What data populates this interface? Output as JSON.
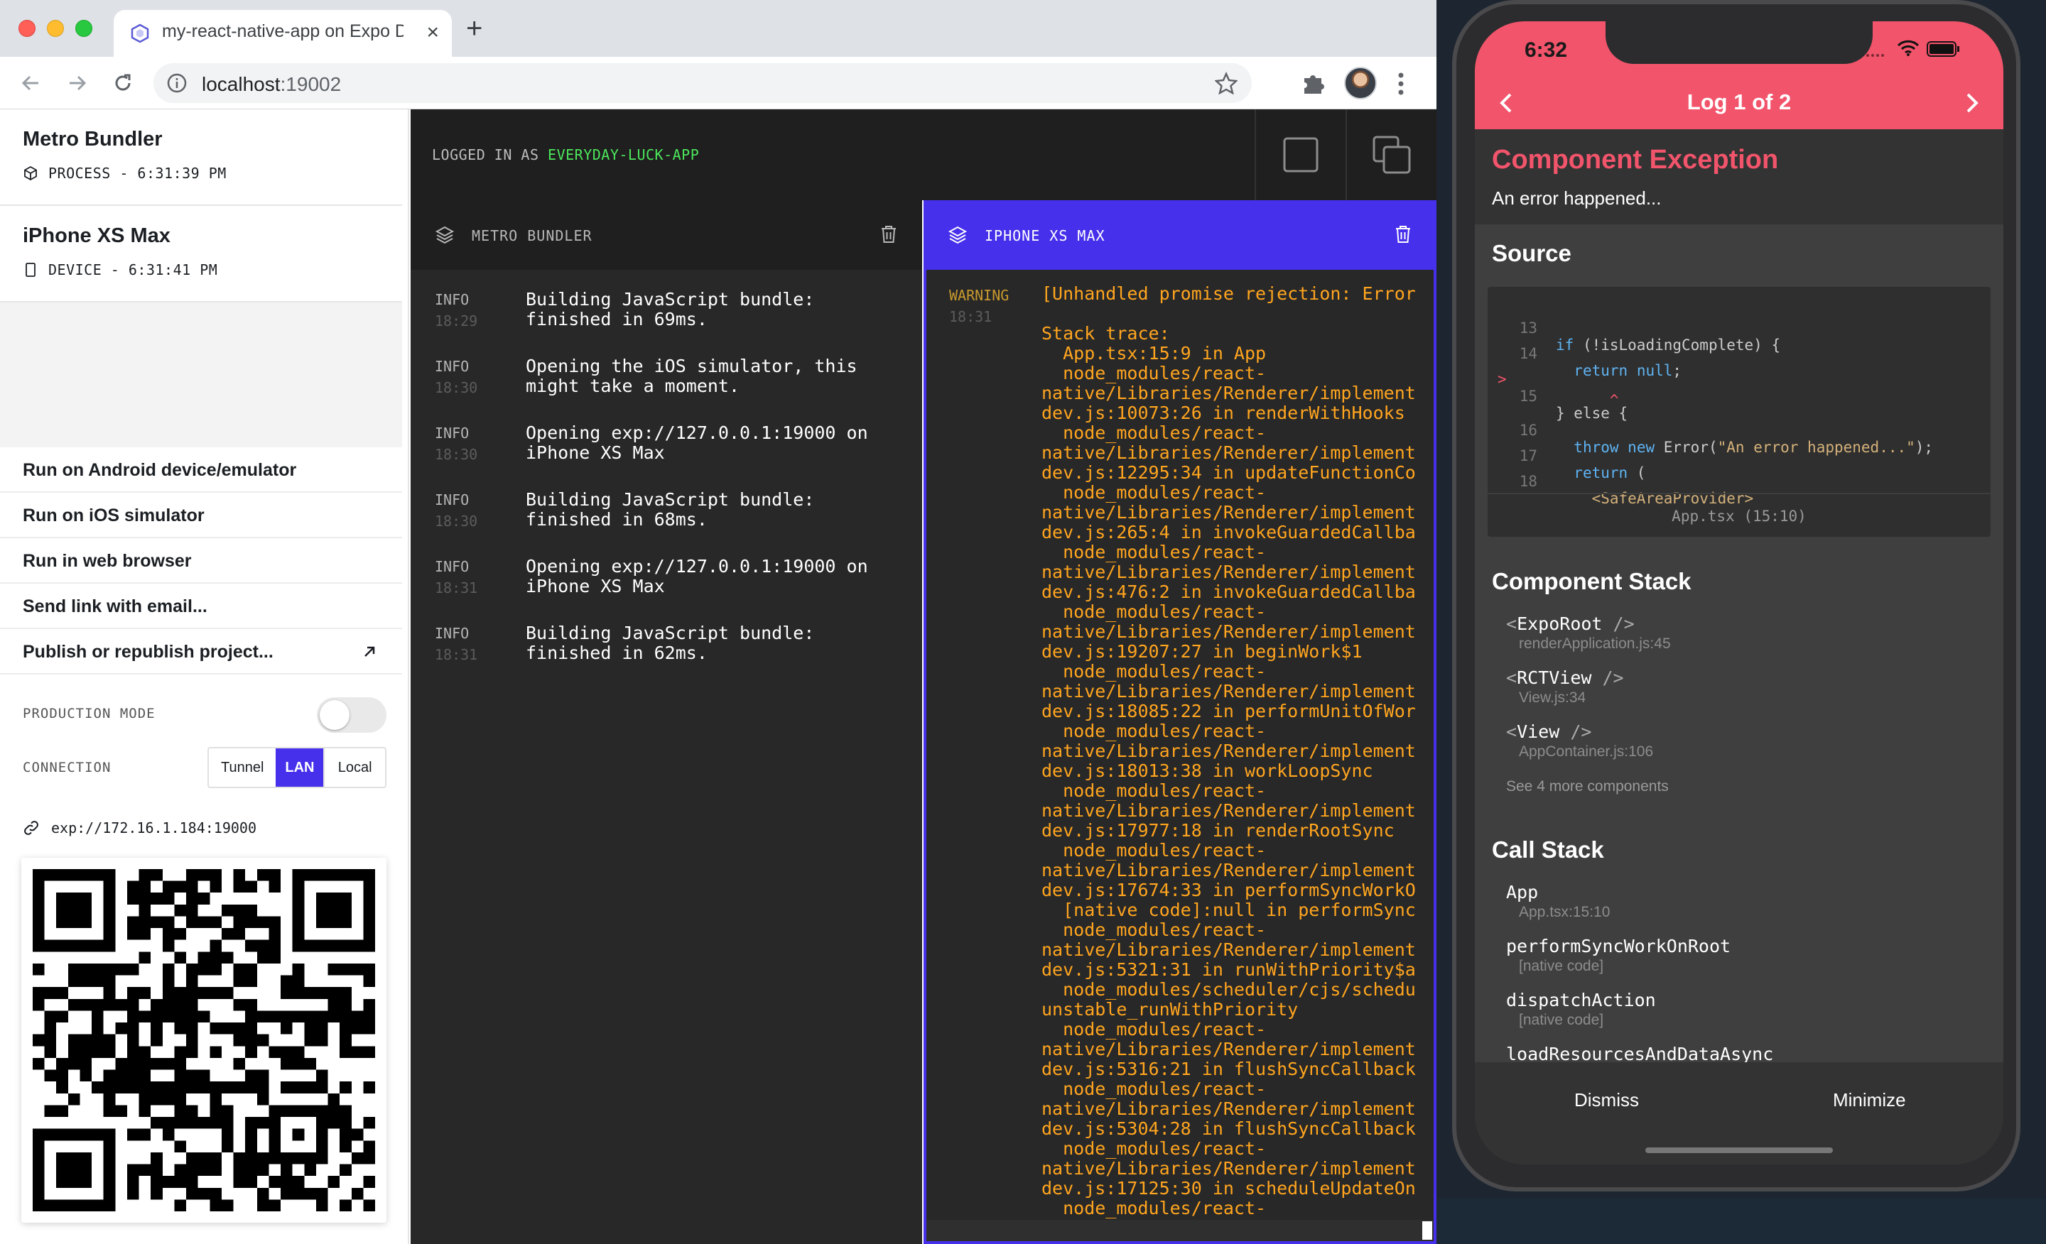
{
  "browser": {
    "tab_title": "my-react-native-app on Expo Dev Tools",
    "url_host": "localhost",
    "url_port": ":19002"
  },
  "sidebar": {
    "sources": [
      {
        "title": "Metro Bundler",
        "kind": "PROCESS - 6:31:39 PM"
      },
      {
        "title": "iPhone XS Max",
        "kind": "DEVICE - 6:31:41 PM"
      }
    ],
    "actions": [
      "Run on Android device/emulator",
      "Run on iOS simulator",
      "Run in web browser",
      "Send link with email...",
      "Publish or republish project..."
    ],
    "production_mode_label": "PRODUCTION MODE",
    "production_mode_on": false,
    "connection_label": "CONNECTION",
    "connection_options": [
      "Tunnel",
      "LAN",
      "Local"
    ],
    "connection_selected": "LAN",
    "exp_url": "exp://172.16.1.184:19000"
  },
  "header": {
    "logged_in_prefix": "LOGGED IN AS",
    "username": "EVERYDAY-LUCK-APP"
  },
  "metro_pane": {
    "title": "METRO BUNDLER",
    "logs": [
      {
        "level": "INFO",
        "time": "18:29",
        "message": "Building JavaScript bundle:\nfinished in 69ms."
      },
      {
        "level": "INFO",
        "time": "18:30",
        "message": "Opening the iOS simulator, this\nmight take a moment."
      },
      {
        "level": "INFO",
        "time": "18:30",
        "message": "Opening exp://127.0.0.1:19000 on\niPhone XS Max"
      },
      {
        "level": "INFO",
        "time": "18:30",
        "message": "Building JavaScript bundle:\nfinished in 68ms."
      },
      {
        "level": "INFO",
        "time": "18:31",
        "message": "Opening exp://127.0.0.1:19000 on\niPhone XS Max"
      },
      {
        "level": "INFO",
        "time": "18:31",
        "message": "Building JavaScript bundle:\nfinished in 62ms."
      }
    ]
  },
  "iphone_pane": {
    "title": "IPHONE XS MAX",
    "level": "WARNING",
    "time": "18:31",
    "message": "[Unhandled promise rejection: Error\n\nStack trace:\n  App.tsx:15:9 in App\n  node_modules/react-\nnative/Libraries/Renderer/implement\ndev.js:10073:26 in renderWithHooks\n  node_modules/react-\nnative/Libraries/Renderer/implement\ndev.js:12295:34 in updateFunctionCo\n  node_modules/react-\nnative/Libraries/Renderer/implement\ndev.js:265:4 in invokeGuardedCallba\n  node_modules/react-\nnative/Libraries/Renderer/implement\ndev.js:476:2 in invokeGuardedCallba\n  node_modules/react-\nnative/Libraries/Renderer/implement\ndev.js:19207:27 in beginWork$1\n  node_modules/react-\nnative/Libraries/Renderer/implement\ndev.js:18085:22 in performUnitOfWor\n  node_modules/react-\nnative/Libraries/Renderer/implement\ndev.js:18013:38 in workLoopSync\n  node_modules/react-\nnative/Libraries/Renderer/implement\ndev.js:17977:18 in renderRootSync\n  node_modules/react-\nnative/Libraries/Renderer/implement\ndev.js:17674:33 in performSyncWorkO\n  [native code]:null in performSync\n  node_modules/react-\nnative/Libraries/Renderer/implement\ndev.js:5321:31 in runWithPriority$a\n  node_modules/scheduler/cjs/schedu\nunstable_runWithPriority\n  node_modules/react-\nnative/Libraries/Renderer/implement\ndev.js:5316:21 in flushSyncCallback\n  node_modules/react-\nnative/Libraries/Renderer/implement\ndev.js:5304:28 in flushSyncCallback\n  node_modules/react-\nnative/Libraries/Renderer/implement\ndev.js:17125:30 in scheduleUpdateOn\n  node_modules/react-"
  },
  "phone": {
    "status_time": "6:32",
    "log_title": "Log 1 of 2",
    "exception_title": "Component Exception",
    "exception_message": "An error happened...",
    "source_title": "Source",
    "code_lines": [
      {
        "num": "13",
        "mark": "",
        "code": "if (!isLoadingComplete) {"
      },
      {
        "num": "14",
        "mark": "",
        "code": "  return null;"
      },
      {
        "num": "15",
        "mark": ">",
        "code": "} else {"
      },
      {
        "num": "",
        "mark": "",
        "code": "      ^"
      },
      {
        "num": "16",
        "mark": "",
        "code": "  throw new Error(\"An error happened...\");"
      },
      {
        "num": "17",
        "mark": "",
        "code": "  return ("
      },
      {
        "num": "18",
        "mark": "",
        "code": "    <SafeAreaProvider>"
      }
    ],
    "source_file": "App.tsx (15:10)",
    "component_stack_title": "Component Stack",
    "component_stack": [
      {
        "name": "ExpoRoot",
        "file": "renderApplication.js:45"
      },
      {
        "name": "RCTView",
        "file": "View.js:34"
      },
      {
        "name": "View",
        "file": "AppContainer.js:106"
      }
    ],
    "see_more": "See 4 more components",
    "call_stack_title": "Call Stack",
    "call_stack": [
      {
        "name": "App",
        "file": "App.tsx:15:10"
      },
      {
        "name": "performSyncWorkOnRoot",
        "file": "[native code]"
      },
      {
        "name": "dispatchAction",
        "file": "[native code]"
      },
      {
        "name": "loadResourcesAndDataAsync",
        "file": ""
      }
    ],
    "dismiss_label": "Dismiss",
    "minimize_label": "Minimize"
  }
}
